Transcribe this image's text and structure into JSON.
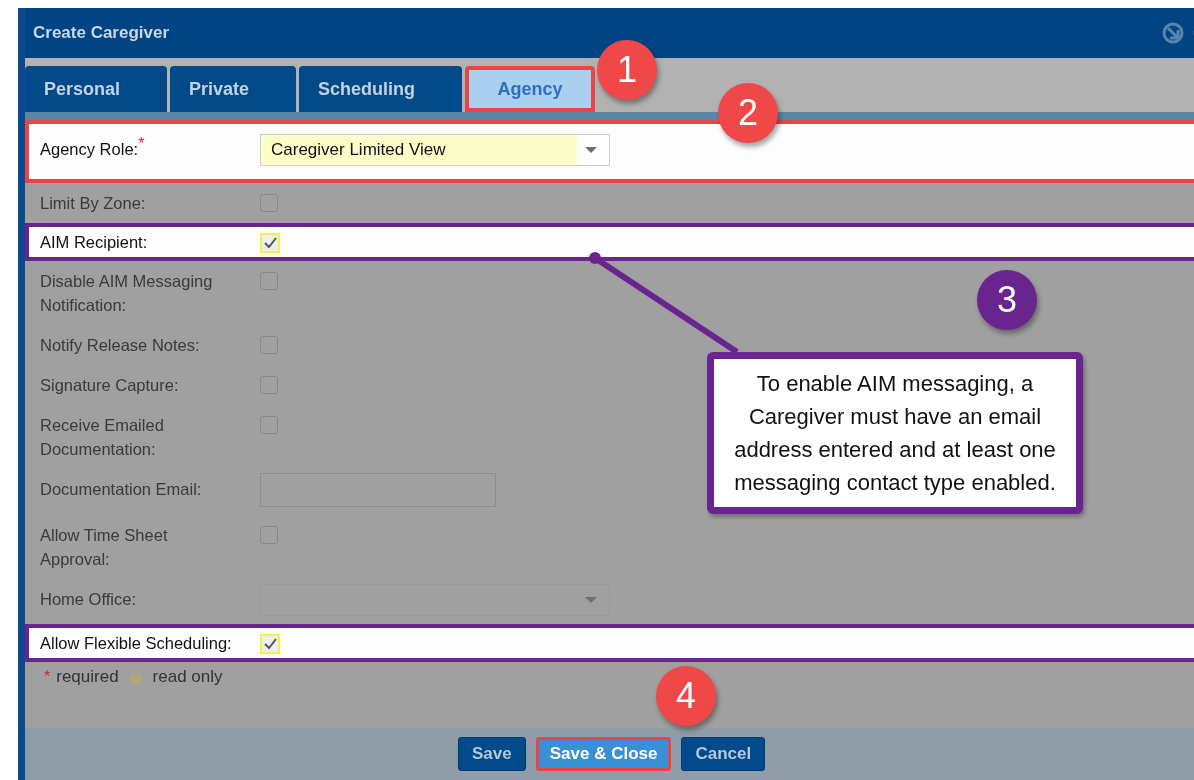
{
  "window": {
    "title": "Create Caregiver"
  },
  "tabs": [
    {
      "label": "Personal",
      "selected": false,
      "outlined": false
    },
    {
      "label": "Private",
      "selected": false,
      "outlined": false
    },
    {
      "label": "Scheduling",
      "selected": false,
      "outlined": false
    },
    {
      "label": "Agency",
      "selected": true,
      "outlined": true
    }
  ],
  "fields": [
    {
      "kind": "select",
      "label": "Agency Role:",
      "required_mark": "*",
      "value": "Caregiver Limited View",
      "color": "#e84545"
    },
    {
      "kind": "checkbox",
      "label": "Limit By Zone:",
      "checked": false
    },
    {
      "kind": "checkbox",
      "label": "AIM Recipient:",
      "checked": true,
      "color": "#6a2490"
    },
    {
      "kind": "checkbox",
      "label": "Disable AIM Messaging Notification:",
      "checked": false
    },
    {
      "kind": "checkbox",
      "label": "Notify Release Notes:",
      "checked": false
    },
    {
      "kind": "checkbox",
      "label": "Signature Capture:",
      "checked": false
    },
    {
      "kind": "checkbox",
      "label": "Receive Emailed Documentation:",
      "checked": false
    },
    {
      "kind": "text",
      "label": "Documentation Email:"
    },
    {
      "kind": "checkbox",
      "label": "Allow Time Sheet Approval:",
      "checked": false
    },
    {
      "kind": "select",
      "label": "Home Office:"
    },
    {
      "kind": "checkbox",
      "label": "Allow Flexible Scheduling:",
      "checked": true,
      "color": "#6a2490"
    }
  ],
  "legend": {
    "required_mark": "*",
    "required": "required",
    "read_only": "read only"
  },
  "buttons": [
    {
      "label": "Save",
      "selected": false,
      "outlined": false
    },
    {
      "label": "Save & Close",
      "selected": true,
      "outlined": true
    },
    {
      "label": "Cancel",
      "selected": false,
      "outlined": false
    }
  ],
  "callouts": [
    {
      "number": "1",
      "color": "#f04848"
    },
    {
      "number": "2",
      "color": "#f04848"
    },
    {
      "number": "3",
      "color": "#6a2490"
    },
    {
      "number": "4",
      "color": "#f04848"
    }
  ],
  "note": {
    "text": "To enable AIM messaging, a Caregiver must have an email address entered and at least one messaging contact type enabled."
  }
}
